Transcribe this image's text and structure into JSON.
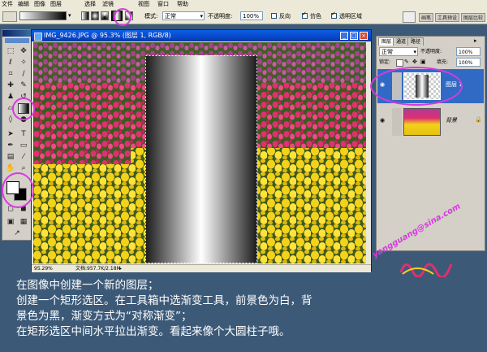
{
  "menubar": {
    "items": [
      "文件",
      "编辑",
      "图像",
      "图层",
      "选择",
      "滤镜",
      "视图",
      "窗口",
      "帮助"
    ]
  },
  "options": {
    "mode_label": "模式:",
    "mode_value": "正常",
    "opacity_label": "不透明度:",
    "opacity_value": "100%",
    "reverse_label": "反向",
    "dither_label": "仿色",
    "transparency_label": "透明区域"
  },
  "dock": {
    "tabs": [
      "画笔",
      "工具预设",
      "图层比较"
    ]
  },
  "document": {
    "title": "IMG_9426.JPG @ 95.3% (图层 1, RGB/8)",
    "zoom": "95.29%",
    "doc_size": "文档:957.7K/2.18M"
  },
  "layers_panel": {
    "tabs": [
      "图层",
      "通道",
      "路径"
    ],
    "blend_mode": "正常",
    "opacity_label": "不透明度:",
    "opacity_value": "100%",
    "lock_label": "锁定:",
    "fill_label": "填充:",
    "fill_value": "100%",
    "layers": [
      {
        "name": "图层 1",
        "selected": true
      },
      {
        "name": "背景",
        "selected": false
      }
    ]
  },
  "watermark": "yangguang@sina.com",
  "caption": {
    "lines": [
      "在图像中创建一个新的图层；",
      "创建一个矩形选区。在工具箱中选渐变工具，前景色为白，背",
      "景色为黑，渐变方式为“对称渐变”；",
      "在矩形选区中间水平拉出渐变。看起来像个大圆柱子哦。"
    ]
  },
  "colors": {
    "accent_highlight": "#d83ae0",
    "titlebar": "#0a47c8",
    "desktop": "#3c5a78"
  }
}
